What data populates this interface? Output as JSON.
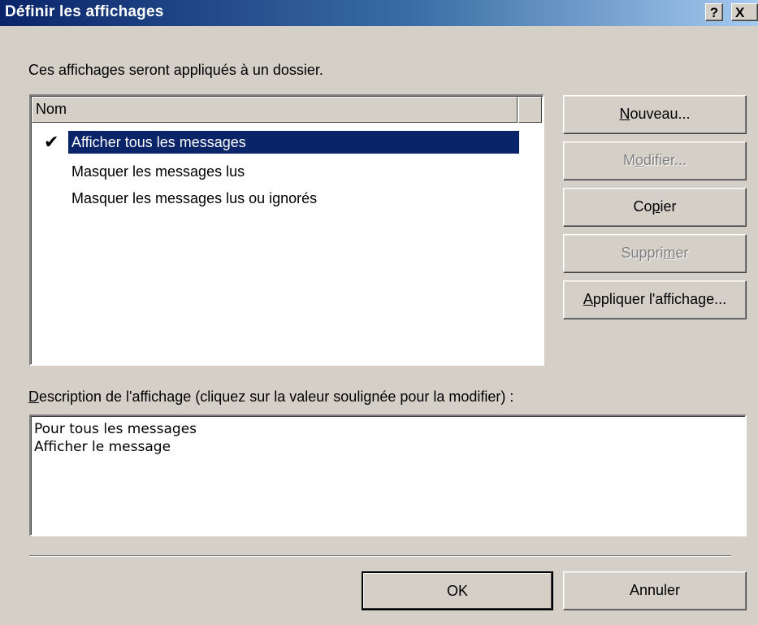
{
  "window": {
    "title": "Définir les affichages",
    "help_glyph": "?",
    "close_glyph": "X"
  },
  "intro_text": "Ces affichages seront appliqués à un dossier.",
  "list": {
    "column_header": "Nom",
    "check_glyph": "✔",
    "items": [
      {
        "label": "Afficher tous les messages",
        "checked": true,
        "selected": true
      },
      {
        "label": "Masquer les messages lus",
        "checked": false,
        "selected": false
      },
      {
        "label": "Masquer les messages lus ou ignorés",
        "checked": false,
        "selected": false
      }
    ]
  },
  "side_buttons": {
    "new": {
      "pre": "",
      "mnemonic": "N",
      "post": "ouveau...",
      "enabled": true
    },
    "modify": {
      "pre": "M",
      "mnemonic": "o",
      "post": "difier...",
      "enabled": false
    },
    "copy": {
      "pre": "Co",
      "mnemonic": "p",
      "post": "ier",
      "enabled": true
    },
    "delete": {
      "pre": "Suppri",
      "mnemonic": "m",
      "post": "er",
      "enabled": false
    },
    "apply": {
      "pre": "",
      "mnemonic": "A",
      "post": "ppliquer l'affichage...",
      "enabled": true
    }
  },
  "description": {
    "label_mnemonic": "D",
    "label_rest": "escription de l'affichage (cliquez sur la valeur soulignée pour la modifier) :",
    "lines": [
      "Pour tous les messages",
      "Afficher le message"
    ]
  },
  "footer": {
    "ok_label": "OK",
    "cancel_label": "Annuler"
  }
}
